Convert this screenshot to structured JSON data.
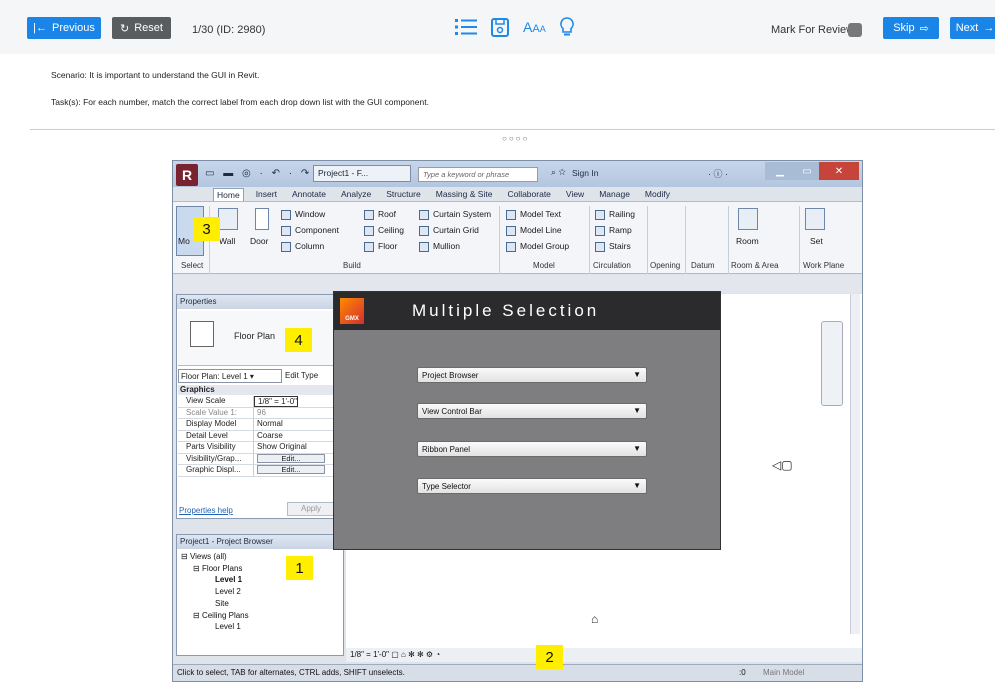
{
  "header": {
    "previous_label": "Previous",
    "reset_label": "Reset",
    "counter": "1/30 (ID: 2980)",
    "mark_review_label": "Mark For Review",
    "skip_label": "Skip",
    "next_label": "Next"
  },
  "question": {
    "scenario": "Scenario: It is important to understand the GUI in Revit.",
    "task": "Task(s): For each number, match the correct label from each drop down list with the GUI component.",
    "dots": "○○○○"
  },
  "revit": {
    "logo": "R",
    "project_tab": "Project1 - F...",
    "search_placeholder": "Type a keyword or phrase",
    "sign_in": "Sign In",
    "tabs": [
      "Home",
      "Insert",
      "Annotate",
      "Analyze",
      "Structure",
      "Massing & Site",
      "Collaborate",
      "View",
      "Manage",
      "Modify"
    ],
    "ribbon": {
      "modify": "Mo",
      "wall": "Wall",
      "door": "Door",
      "window": "Window",
      "component": "Component",
      "column": "Column",
      "roof": "Roof",
      "ceiling": "Ceiling",
      "floor": "Floor",
      "curtain_system": "Curtain System",
      "curtain_grid": "Curtain Grid",
      "mullion": "Mullion",
      "model_text": "Model Text",
      "model_line": "Model Line",
      "model_group": "Model Group",
      "railing": "Railing",
      "ramp": "Ramp",
      "stairs": "Stairs",
      "room": "Room",
      "set": "Set",
      "groups": [
        "Select",
        "Build",
        "Model",
        "Circulation",
        "Opening",
        "Datum",
        "Room & Area",
        "Work Plane"
      ]
    },
    "properties": {
      "title": "Properties",
      "type_name": "Floor Plan",
      "selector": "Floor Plan: Level 1",
      "edit_type": "Edit Type",
      "section": "Graphics",
      "rows": [
        {
          "k": "View Scale",
          "v": "1/8\" = 1'-0\""
        },
        {
          "k": "Scale Value  1:",
          "v": "96"
        },
        {
          "k": "Display Model",
          "v": "Normal"
        },
        {
          "k": "Detail Level",
          "v": "Coarse"
        },
        {
          "k": "Parts Visibility",
          "v": "Show Original"
        },
        {
          "k": "Visibility/Grap...",
          "v": "Edit..."
        },
        {
          "k": "Graphic Displ...",
          "v": "Edit..."
        }
      ],
      "help": "Properties help",
      "apply": "Apply"
    },
    "browser": {
      "title": "Project1 - Project Browser",
      "items": [
        "Views (all)",
        "Floor Plans",
        "Level 1",
        "Level 2",
        "Site",
        "Ceiling Plans",
        "Level 1"
      ]
    },
    "view_control": "1/8\" = 1'-0\"",
    "status": "Click to select, TAB for alternates, CTRL adds, SHIFT unselects.",
    "status_zero": ":0",
    "main_model": "Main Model"
  },
  "badges": [
    "3",
    "4",
    "1",
    "2"
  ],
  "modal": {
    "title": "Multiple Selection",
    "logo": "GMX",
    "dropdowns": [
      "Project Browser",
      "View Control Bar",
      "Ribbon Panel",
      "Type Selector"
    ]
  }
}
